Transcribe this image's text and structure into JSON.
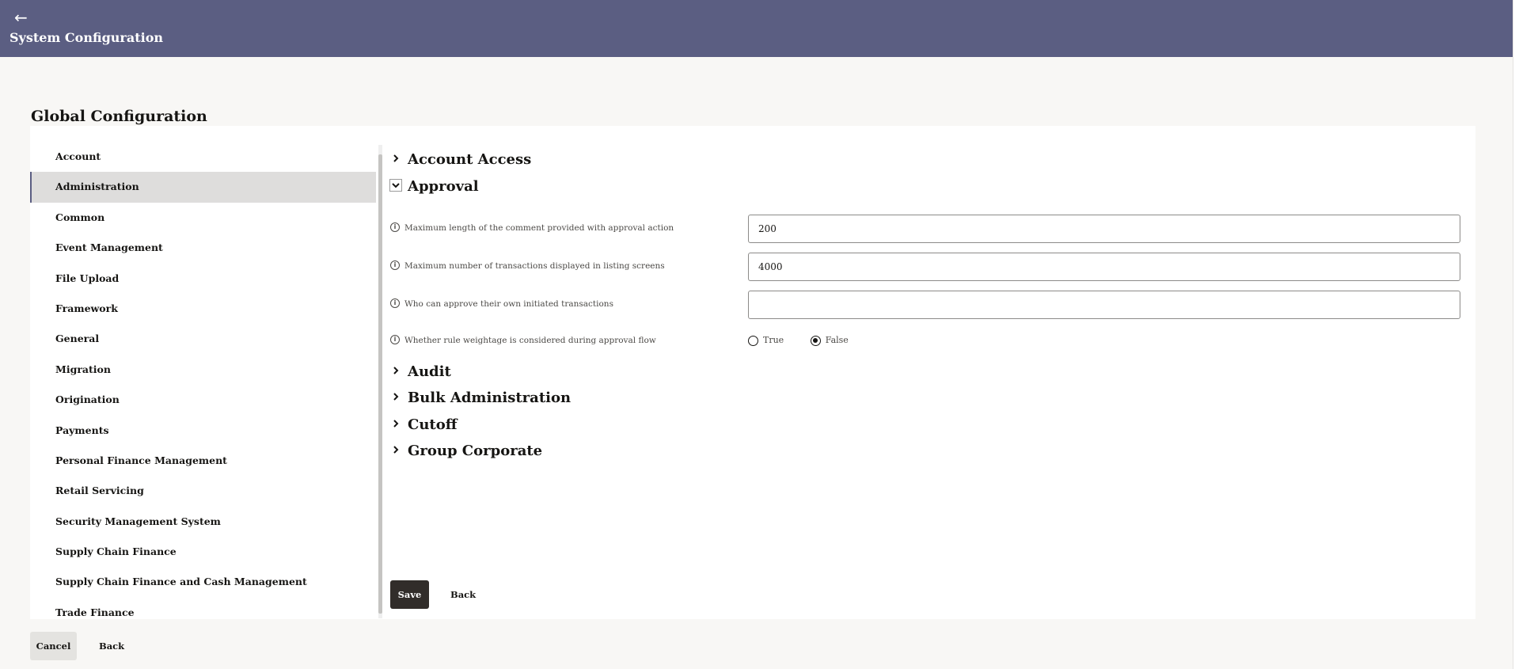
{
  "header": {
    "back_icon": "arrow-left-icon",
    "title": "System Configuration"
  },
  "page": {
    "title": "Global Configuration"
  },
  "nav": {
    "items": [
      {
        "label": "Account"
      },
      {
        "label": "Administration",
        "active": true
      },
      {
        "label": "Common"
      },
      {
        "label": "Event Management"
      },
      {
        "label": "File Upload"
      },
      {
        "label": "Framework"
      },
      {
        "label": "General"
      },
      {
        "label": "Migration"
      },
      {
        "label": "Origination"
      },
      {
        "label": "Payments"
      },
      {
        "label": "Personal Finance Management"
      },
      {
        "label": "Retail Servicing"
      },
      {
        "label": "Security Management System"
      },
      {
        "label": "Supply Chain Finance"
      },
      {
        "label": "Supply Chain Finance and Cash Management"
      },
      {
        "label": "Trade Finance"
      }
    ]
  },
  "sections": {
    "account_access": {
      "title": "Account Access"
    },
    "approval": {
      "title": "Approval"
    },
    "audit": {
      "title": "Audit"
    },
    "bulk_administration": {
      "title": "Bulk Administration"
    },
    "cutoff": {
      "title": "Cutoff"
    },
    "group_corporate": {
      "title": "Group Corporate"
    }
  },
  "approval_fields": {
    "max_comment_length": {
      "label": "Maximum length of the comment provided with approval action",
      "value": "200"
    },
    "max_transactions": {
      "label": "Maximum number of transactions displayed in listing screens",
      "value": "4000"
    },
    "self_approval": {
      "label": "Who can approve their own initiated transactions",
      "value": ""
    },
    "rule_weightage": {
      "label": "Whether rule weightage is considered during approval flow",
      "options": [
        "True",
        "False"
      ],
      "selected": "False"
    }
  },
  "actions": {
    "save": "Save",
    "back": "Back",
    "cancel": "Cancel",
    "back_outer": "Back"
  },
  "icons": {
    "info": "i"
  }
}
